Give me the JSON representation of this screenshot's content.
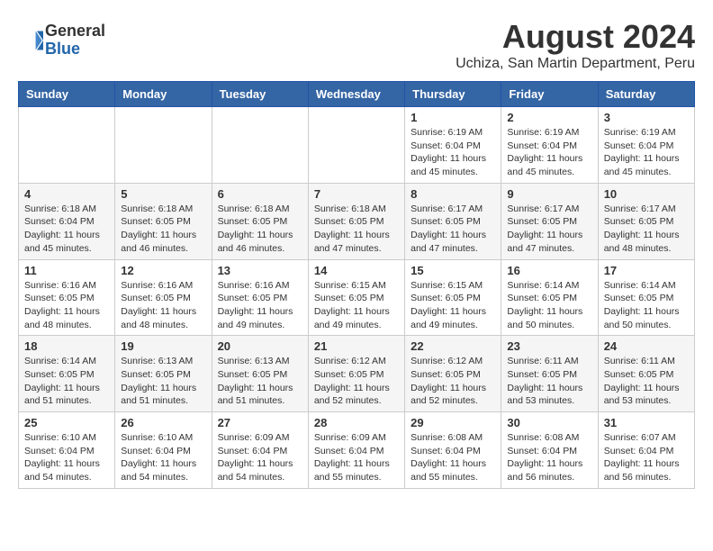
{
  "logo": {
    "general": "General",
    "blue": "Blue"
  },
  "title": {
    "month_year": "August 2024",
    "location": "Uchiza, San Martin Department, Peru"
  },
  "headers": [
    "Sunday",
    "Monday",
    "Tuesday",
    "Wednesday",
    "Thursday",
    "Friday",
    "Saturday"
  ],
  "weeks": [
    [
      {
        "day": "",
        "info": ""
      },
      {
        "day": "",
        "info": ""
      },
      {
        "day": "",
        "info": ""
      },
      {
        "day": "",
        "info": ""
      },
      {
        "day": "1",
        "info": "Sunrise: 6:19 AM\nSunset: 6:04 PM\nDaylight: 11 hours\nand 45 minutes."
      },
      {
        "day": "2",
        "info": "Sunrise: 6:19 AM\nSunset: 6:04 PM\nDaylight: 11 hours\nand 45 minutes."
      },
      {
        "day": "3",
        "info": "Sunrise: 6:19 AM\nSunset: 6:04 PM\nDaylight: 11 hours\nand 45 minutes."
      }
    ],
    [
      {
        "day": "4",
        "info": "Sunrise: 6:18 AM\nSunset: 6:04 PM\nDaylight: 11 hours\nand 45 minutes."
      },
      {
        "day": "5",
        "info": "Sunrise: 6:18 AM\nSunset: 6:05 PM\nDaylight: 11 hours\nand 46 minutes."
      },
      {
        "day": "6",
        "info": "Sunrise: 6:18 AM\nSunset: 6:05 PM\nDaylight: 11 hours\nand 46 minutes."
      },
      {
        "day": "7",
        "info": "Sunrise: 6:18 AM\nSunset: 6:05 PM\nDaylight: 11 hours\nand 47 minutes."
      },
      {
        "day": "8",
        "info": "Sunrise: 6:17 AM\nSunset: 6:05 PM\nDaylight: 11 hours\nand 47 minutes."
      },
      {
        "day": "9",
        "info": "Sunrise: 6:17 AM\nSunset: 6:05 PM\nDaylight: 11 hours\nand 47 minutes."
      },
      {
        "day": "10",
        "info": "Sunrise: 6:17 AM\nSunset: 6:05 PM\nDaylight: 11 hours\nand 48 minutes."
      }
    ],
    [
      {
        "day": "11",
        "info": "Sunrise: 6:16 AM\nSunset: 6:05 PM\nDaylight: 11 hours\nand 48 minutes."
      },
      {
        "day": "12",
        "info": "Sunrise: 6:16 AM\nSunset: 6:05 PM\nDaylight: 11 hours\nand 48 minutes."
      },
      {
        "day": "13",
        "info": "Sunrise: 6:16 AM\nSunset: 6:05 PM\nDaylight: 11 hours\nand 49 minutes."
      },
      {
        "day": "14",
        "info": "Sunrise: 6:15 AM\nSunset: 6:05 PM\nDaylight: 11 hours\nand 49 minutes."
      },
      {
        "day": "15",
        "info": "Sunrise: 6:15 AM\nSunset: 6:05 PM\nDaylight: 11 hours\nand 49 minutes."
      },
      {
        "day": "16",
        "info": "Sunrise: 6:14 AM\nSunset: 6:05 PM\nDaylight: 11 hours\nand 50 minutes."
      },
      {
        "day": "17",
        "info": "Sunrise: 6:14 AM\nSunset: 6:05 PM\nDaylight: 11 hours\nand 50 minutes."
      }
    ],
    [
      {
        "day": "18",
        "info": "Sunrise: 6:14 AM\nSunset: 6:05 PM\nDaylight: 11 hours\nand 51 minutes."
      },
      {
        "day": "19",
        "info": "Sunrise: 6:13 AM\nSunset: 6:05 PM\nDaylight: 11 hours\nand 51 minutes."
      },
      {
        "day": "20",
        "info": "Sunrise: 6:13 AM\nSunset: 6:05 PM\nDaylight: 11 hours\nand 51 minutes."
      },
      {
        "day": "21",
        "info": "Sunrise: 6:12 AM\nSunset: 6:05 PM\nDaylight: 11 hours\nand 52 minutes."
      },
      {
        "day": "22",
        "info": "Sunrise: 6:12 AM\nSunset: 6:05 PM\nDaylight: 11 hours\nand 52 minutes."
      },
      {
        "day": "23",
        "info": "Sunrise: 6:11 AM\nSunset: 6:05 PM\nDaylight: 11 hours\nand 53 minutes."
      },
      {
        "day": "24",
        "info": "Sunrise: 6:11 AM\nSunset: 6:05 PM\nDaylight: 11 hours\nand 53 minutes."
      }
    ],
    [
      {
        "day": "25",
        "info": "Sunrise: 6:10 AM\nSunset: 6:04 PM\nDaylight: 11 hours\nand 54 minutes."
      },
      {
        "day": "26",
        "info": "Sunrise: 6:10 AM\nSunset: 6:04 PM\nDaylight: 11 hours\nand 54 minutes."
      },
      {
        "day": "27",
        "info": "Sunrise: 6:09 AM\nSunset: 6:04 PM\nDaylight: 11 hours\nand 54 minutes."
      },
      {
        "day": "28",
        "info": "Sunrise: 6:09 AM\nSunset: 6:04 PM\nDaylight: 11 hours\nand 55 minutes."
      },
      {
        "day": "29",
        "info": "Sunrise: 6:08 AM\nSunset: 6:04 PM\nDaylight: 11 hours\nand 55 minutes."
      },
      {
        "day": "30",
        "info": "Sunrise: 6:08 AM\nSunset: 6:04 PM\nDaylight: 11 hours\nand 56 minutes."
      },
      {
        "day": "31",
        "info": "Sunrise: 6:07 AM\nSunset: 6:04 PM\nDaylight: 11 hours\nand 56 minutes."
      }
    ]
  ]
}
